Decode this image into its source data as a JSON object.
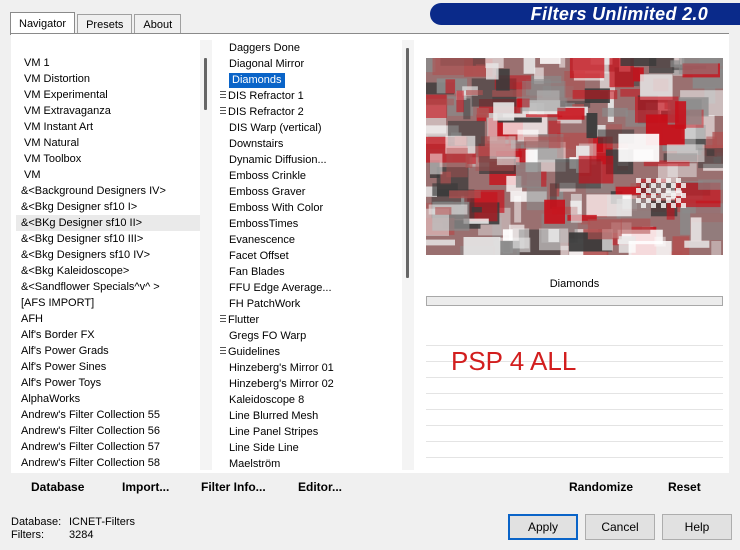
{
  "tabs": [
    {
      "label": "Navigator",
      "active": true
    },
    {
      "label": "Presets",
      "active": false
    },
    {
      "label": "About",
      "active": false
    }
  ],
  "app_title": "Filters Unlimited 2.0",
  "categories": [
    {
      "label": "VM 1"
    },
    {
      "label": "VM Distortion"
    },
    {
      "label": "VM Experimental"
    },
    {
      "label": "VM Extravaganza"
    },
    {
      "label": "VM Instant Art"
    },
    {
      "label": "VM Natural"
    },
    {
      "label": "VM Toolbox"
    },
    {
      "label": "VM"
    },
    {
      "label": "&<Background Designers IV>"
    },
    {
      "label": "&<Bkg Designer sf10 I>"
    },
    {
      "label": "&<BKg Designer sf10 II>",
      "focus": true
    },
    {
      "label": "&<Bkg Designer sf10 III>"
    },
    {
      "label": "&<Bkg Designers sf10 IV>"
    },
    {
      "label": "&<Bkg Kaleidoscope>"
    },
    {
      "label": "&<Sandflower Specials^v^ >"
    },
    {
      "label": "[AFS IMPORT]"
    },
    {
      "label": "AFH"
    },
    {
      "label": "Alf's Border FX"
    },
    {
      "label": "Alf's Power Grads"
    },
    {
      "label": "Alf's Power Sines"
    },
    {
      "label": "Alf's Power Toys"
    },
    {
      "label": "AlphaWorks"
    },
    {
      "label": "Andrew's Filter Collection 55"
    },
    {
      "label": "Andrew's Filter Collection 56"
    },
    {
      "label": "Andrew's Filter Collection 57"
    },
    {
      "label": "Andrew's Filter Collection 58"
    }
  ],
  "filters": [
    {
      "label": "Daggers Done"
    },
    {
      "label": "Diagonal Mirror"
    },
    {
      "label": "Diamonds",
      "selected": true
    },
    {
      "label": "DIS Refractor 1",
      "marked": true
    },
    {
      "label": "DIS Refractor 2",
      "marked": true
    },
    {
      "label": "DIS Warp (vertical)"
    },
    {
      "label": "Downstairs"
    },
    {
      "label": "Dynamic Diffusion..."
    },
    {
      "label": "Emboss Crinkle"
    },
    {
      "label": "Emboss Graver"
    },
    {
      "label": "Emboss With Color"
    },
    {
      "label": "EmbossTimes"
    },
    {
      "label": "Evanescence"
    },
    {
      "label": "Facet Offset"
    },
    {
      "label": "Fan Blades"
    },
    {
      "label": "FFU Edge Average..."
    },
    {
      "label": "FH PatchWork"
    },
    {
      "label": "Flutter",
      "marked": true
    },
    {
      "label": "Gregs FO Warp"
    },
    {
      "label": "Guidelines",
      "marked": true
    },
    {
      "label": "Hinzeberg's Mirror 01"
    },
    {
      "label": "Hinzeberg's Mirror 02"
    },
    {
      "label": "Kaleidoscope 8"
    },
    {
      "label": "Line Blurred Mesh"
    },
    {
      "label": "Line Panel Stripes"
    },
    {
      "label": "Line Side Line"
    },
    {
      "label": "Maelström"
    }
  ],
  "preview": {
    "filter_name": "Diamonds",
    "watermark": "PSP 4 ALL",
    "colors": [
      "#c8101a",
      "#e8e8e8",
      "#8a8a8a",
      "#ffffff",
      "#3a3a3a",
      "#b05050"
    ]
  },
  "toolbar": {
    "database": "Database",
    "import": "Import...",
    "filter_info": "Filter Info...",
    "editor": "Editor...",
    "randomize": "Randomize",
    "reset": "Reset"
  },
  "status": {
    "database_label": "Database:",
    "database_value": "ICNET-Filters",
    "filters_label": "Filters:",
    "filters_value": "3284"
  },
  "buttons": {
    "apply": "Apply",
    "cancel": "Cancel",
    "help": "Help"
  }
}
